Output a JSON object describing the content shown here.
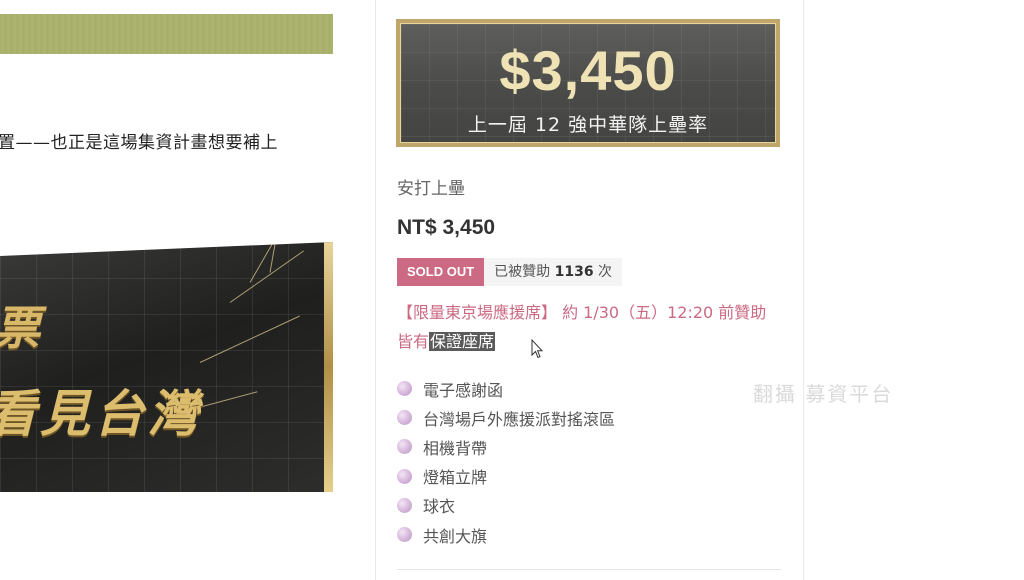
{
  "left": {
    "article_text": "置——也正是這場集資計畫想要補上",
    "promo_line1": "票",
    "promo_line2": "看見台灣"
  },
  "reward": {
    "badge_price": "$3,450",
    "badge_subtitle": "上一屆 12 強中華隊上壘率",
    "title": "安打上壘",
    "price": "NT$ 3,450",
    "status_badge": "SOLD OUT",
    "backers_prefix": "已被贊助 ",
    "backers_count": "1136",
    "backers_suffix": " 次",
    "note_text": "【限量東京場應援席】 約 1/30（五）12:20 前贊助皆有",
    "note_highlight": "保證座席",
    "items": [
      "電子感謝函",
      "台灣場戶外應援派對搖滾區",
      "相機背帶",
      "燈箱立牌",
      "球衣",
      "共創大旗"
    ]
  },
  "watermark": "翻攝 募資平台",
  "colors": {
    "accent_pink": "#cb6a82",
    "gold": "#bfa66a",
    "badge_dark": "#4a4a48",
    "olive_banner": "#a8b06a"
  },
  "icons": {
    "bullet": "purple-orb-icon",
    "cursor": "mouse-pointer-icon"
  }
}
